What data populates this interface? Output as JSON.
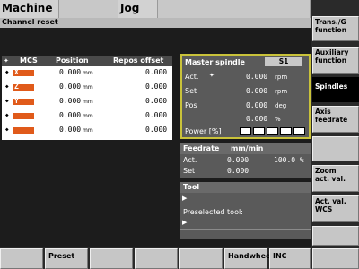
{
  "header": {
    "tabs": [
      {
        "label": "Machine"
      },
      {
        "label": ""
      },
      {
        "label": "Jog"
      },
      {
        "label": ""
      }
    ],
    "status_line": "Channel reset"
  },
  "right_softkeys": [
    {
      "label": "Trans./G\nfunction",
      "active": false
    },
    {
      "label": "Auxiliary\nfunction",
      "active": false
    },
    {
      "label": "Spindles",
      "active": true
    },
    {
      "label": "Axis\nfeedrate",
      "active": false
    },
    {
      "label": "",
      "active": false
    },
    {
      "label": "Zoom\nact. val.",
      "active": false
    },
    {
      "label": "Act. val.\nWCS",
      "active": false
    },
    {
      "label": "",
      "active": false
    }
  ],
  "mcs_table": {
    "headers": {
      "mcs": "MCS",
      "position": "Position",
      "repos": "Repos offset"
    },
    "rows": [
      {
        "axis": "X",
        "position": "0.000",
        "unit": "mm",
        "repos": "0.000"
      },
      {
        "axis": "Z",
        "position": "0.000",
        "unit": "mm",
        "repos": "0.000"
      },
      {
        "axis": "Y",
        "position": "0.000",
        "unit": "mm",
        "repos": "0.000"
      },
      {
        "axis": "",
        "position": "0.000",
        "unit": "mm",
        "repos": "0.000"
      },
      {
        "axis": "",
        "position": "0.000",
        "unit": "mm",
        "repos": "0.000"
      }
    ]
  },
  "spindle": {
    "title": "Master spindle",
    "badge": "S1",
    "rows": [
      {
        "label": "Act.",
        "value": "0.000",
        "unit": "rpm"
      },
      {
        "label": "Set",
        "value": "0.000",
        "unit": "rpm"
      },
      {
        "label": "Pos",
        "value": "0.000",
        "unit": "deg"
      },
      {
        "label": "",
        "value": "0.000",
        "unit": "%"
      }
    ],
    "power_label": "Power [%]",
    "power_segments": 5,
    "power_level": 0
  },
  "feedrate": {
    "title": "Feedrate",
    "unit": "mm/min",
    "act_label": "Act.",
    "act_value": "0.000",
    "act_percent": "100.0 %",
    "set_label": "Set",
    "set_value": "0.000"
  },
  "tool": {
    "title": "Tool",
    "preselected_label": "Preselected tool:"
  },
  "bottom_softkeys": [
    {
      "label": ""
    },
    {
      "label": "Preset"
    },
    {
      "label": ""
    },
    {
      "label": ""
    },
    {
      "label": ""
    },
    {
      "label": "Handwheel"
    },
    {
      "label": "INC"
    },
    {
      "label": ""
    }
  ],
  "colors": {
    "axis_marker": "#e05a1a",
    "spindle_border": "#c9c23a",
    "background": "#1c1c1c"
  }
}
